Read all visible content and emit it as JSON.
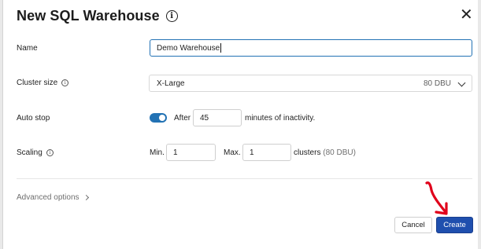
{
  "dialog": {
    "title": "New SQL Warehouse",
    "close_glyph": "✕"
  },
  "form": {
    "name": {
      "label": "Name",
      "value": "Demo Warehouse"
    },
    "cluster_size": {
      "label": "Cluster size",
      "value": "X-Large",
      "dbu": "80 DBU"
    },
    "auto_stop": {
      "label": "Auto stop",
      "enabled": true,
      "prefix": "After",
      "value": "45",
      "suffix": "minutes of inactivity."
    },
    "scaling": {
      "label": "Scaling",
      "min_label": "Min.",
      "min_value": "1",
      "max_label": "Max.",
      "max_value": "1",
      "suffix": "clusters",
      "dbu": "(80 DBU)"
    }
  },
  "advanced": {
    "label": "Advanced options"
  },
  "buttons": {
    "cancel": "Cancel",
    "create": "Create"
  },
  "colors": {
    "primary": "#1f4fae",
    "toggle": "#2272b4",
    "annotation": "#e0001b"
  },
  "icons": {
    "info": "info-icon",
    "close": "close-icon",
    "chevron": "chevron-down-icon"
  }
}
